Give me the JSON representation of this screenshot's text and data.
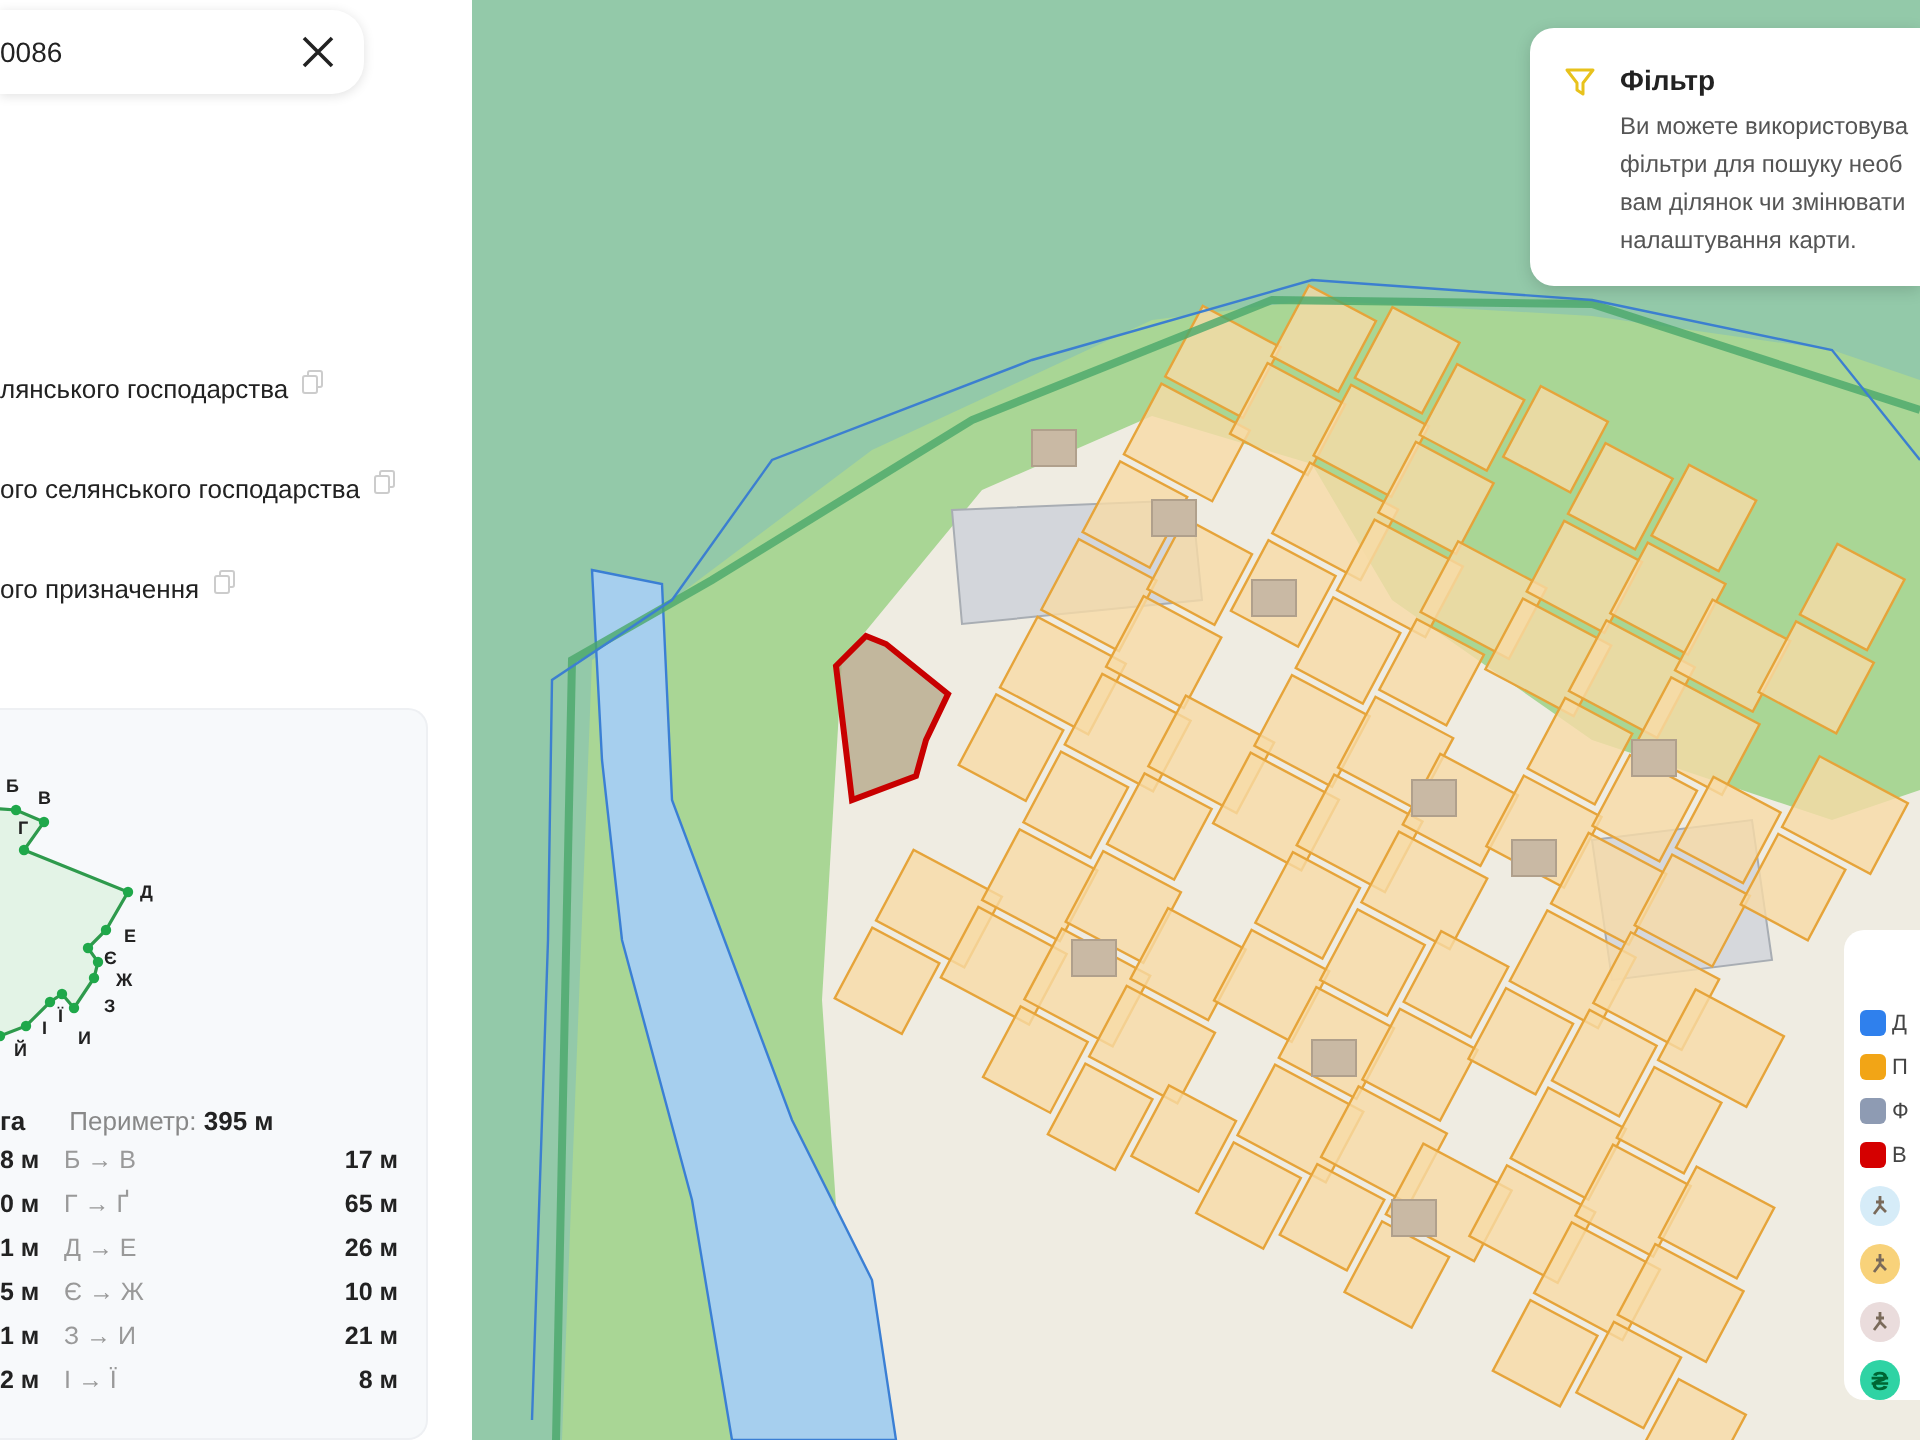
{
  "search": {
    "value": "0086"
  },
  "purposes": [
    {
      "text": "лянського господарства"
    },
    {
      "text": "ого селянського господарства"
    },
    {
      "text": "ого призначення"
    }
  ],
  "parcel_card": {
    "vertices": [
      "Б",
      "В",
      "Г",
      "Д",
      "Е",
      "Є",
      "Ж",
      "З",
      "И",
      "І",
      "Ї",
      "Й"
    ],
    "area": "га",
    "perimeter": "Периметр: **395 м**",
    "segments": [
      {
        "prev": "8 м",
        "name": "Б → В",
        "length": "17 м"
      },
      {
        "prev": "0 м",
        "name": "Г → Ґ",
        "length": "65 м"
      },
      {
        "prev": "1 м",
        "name": "Д → Е",
        "length": "26 м"
      },
      {
        "prev": "5 м",
        "name": "Є → Ж",
        "length": "10 м"
      },
      {
        "prev": "1 м",
        "name": "З → И",
        "length": "21 м"
      },
      {
        "prev": "2 м",
        "name": "І → Ї",
        "length": "8 м"
      }
    ]
  },
  "filter_tip": {
    "title": "Фільтр",
    "lines": [
      "Ви можете використовува",
      "фільтри для пошуку необ",
      "вам ділянок чи змінювати",
      "налаштування карти."
    ]
  },
  "legend": [
    {
      "kind": "swatch",
      "color": "#2f80ed",
      "label": "Д"
    },
    {
      "kind": "swatch",
      "color": "#f2a516",
      "label": "П"
    },
    {
      "kind": "swatch",
      "color": "#8e9bb3",
      "label": "Ф"
    },
    {
      "kind": "swatch",
      "color": "#d50000",
      "label": "В"
    },
    {
      "kind": "badge",
      "color": "#d6ecf8"
    },
    {
      "kind": "badge",
      "color": "#f8d27a"
    },
    {
      "kind": "badge",
      "color": "#eadcdc"
    },
    {
      "kind": "badge",
      "color": "#2fd3a4",
      "glyph": "₴"
    }
  ]
}
